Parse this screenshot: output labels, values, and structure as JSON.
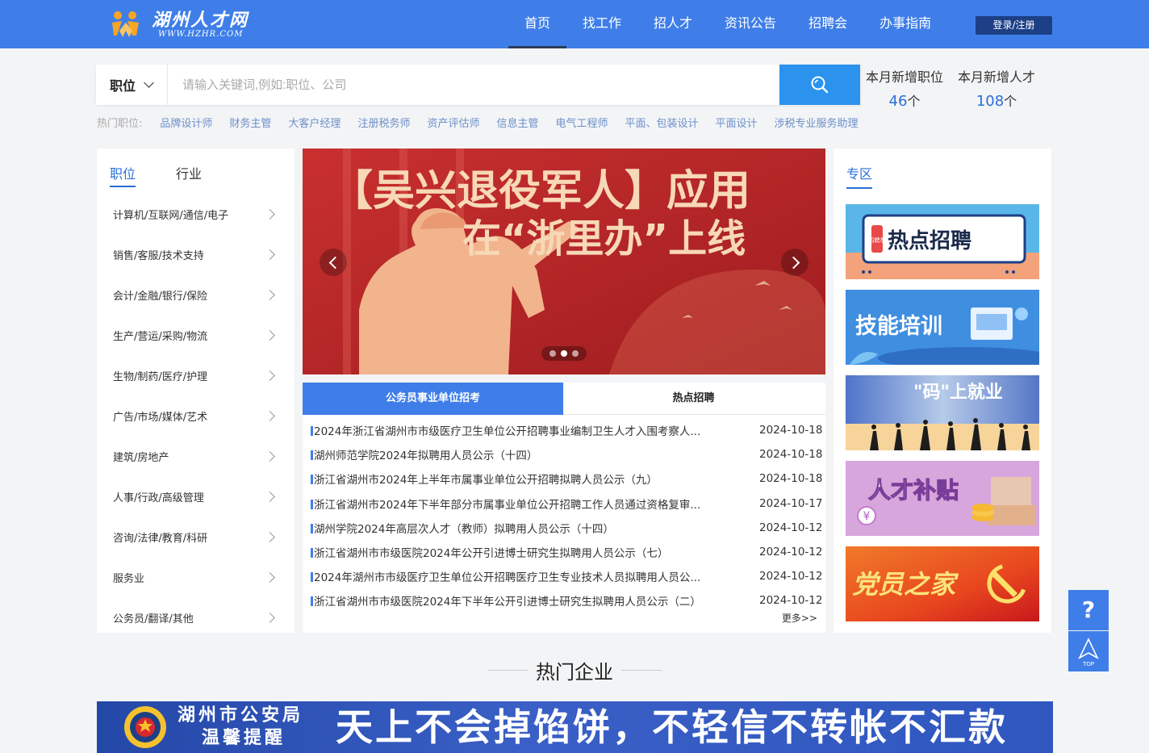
{
  "header": {
    "logo_title": "湖州人才网",
    "logo_sub": "WWW.HZHR.COM",
    "nav": [
      "首页",
      "找工作",
      "招人才",
      "资讯公告",
      "招聘会",
      "办事指南"
    ],
    "login": "登录/注册"
  },
  "search": {
    "type": "职位",
    "placeholder": "请输入关键词,例如:职位、公司",
    "hot_label": "热门职位:",
    "hot_jobs": [
      "品牌设计师",
      "财务主管",
      "大客户经理",
      "注册税务师",
      "资产评估师",
      "信息主管",
      "电气工程师",
      "平面、包装设计",
      "平面设计",
      "涉税专业服务助理"
    ]
  },
  "stats": {
    "jobs_label": "本月新增职位",
    "jobs_value": "46",
    "talent_label": "本月新增人才",
    "talent_value": "108",
    "unit": "个"
  },
  "categories": {
    "tabs": [
      "职位",
      "行业"
    ],
    "items": [
      "计算机/互联网/通信/电子",
      "销售/客服/技术支持",
      "会计/金融/银行/保险",
      "生产/营运/采购/物流",
      "生物/制药/医疗/护理",
      "广告/市场/媒体/艺术",
      "建筑/房地产",
      "人事/行政/高级管理",
      "咨询/法律/教育/科研",
      "服务业",
      "公务员/翻译/其他"
    ]
  },
  "carousel": {
    "headline_1": "【吴兴退役军人】应用",
    "headline_2": "在“浙里办”上线",
    "slide_count": 3,
    "active_slide": 2
  },
  "news": {
    "tabs": [
      "公务员事业单位招考",
      "热点招聘"
    ],
    "items": [
      {
        "title": "2024年浙江省湖州市市级医疗卫生单位公开招聘事业编制卫生人才入围考察人...",
        "date": "2024-10-18"
      },
      {
        "title": "湖州师范学院2024年拟聘用人员公示（十四）",
        "date": "2024-10-18"
      },
      {
        "title": "浙江省湖州市2024年上半年市属事业单位公开招聘拟聘人员公示（九）",
        "date": "2024-10-18"
      },
      {
        "title": "浙江省湖州市2024年下半年部分市属事业单位公开招聘工作人员通过资格复审...",
        "date": "2024-10-17"
      },
      {
        "title": "湖州学院2024年高层次人才（教师）拟聘用人员公示（十四）",
        "date": "2024-10-12"
      },
      {
        "title": "浙江省湖州市市级医院2024年公开引进博士研究生拟聘用人员公示（七）",
        "date": "2024-10-12"
      },
      {
        "title": "2024年湖州市市级医疗卫生单位公开招聘医疗卫生专业技术人员拟聘用人员公...",
        "date": "2024-10-12"
      },
      {
        "title": "浙江省湖州市市级医院2024年下半年公开引进博士研究生拟聘用人员公示（二）",
        "date": "2024-10-12"
      }
    ],
    "more": "更多>>"
  },
  "zone": {
    "title": "专区",
    "banners": [
      {
        "text": "热点招聘",
        "tag": "招聘季"
      },
      {
        "text": "技能培训"
      },
      {
        "text": "\"码\"上就业"
      },
      {
        "text": "人才补贴",
        "symbol": "¥"
      },
      {
        "text": "党员之家"
      }
    ]
  },
  "float": {
    "help": "?",
    "top": "TOP"
  },
  "section": {
    "title": "热门企业"
  },
  "ad": {
    "org_1": "湖州市公安局",
    "org_2": "温馨提醒",
    "slogan": "天上不会掉馅饼，不轻信不转帐不汇款"
  },
  "colors": {
    "brand": "#3f7ee8",
    "link": "#2a6fd6",
    "search": "#2b92ee"
  }
}
